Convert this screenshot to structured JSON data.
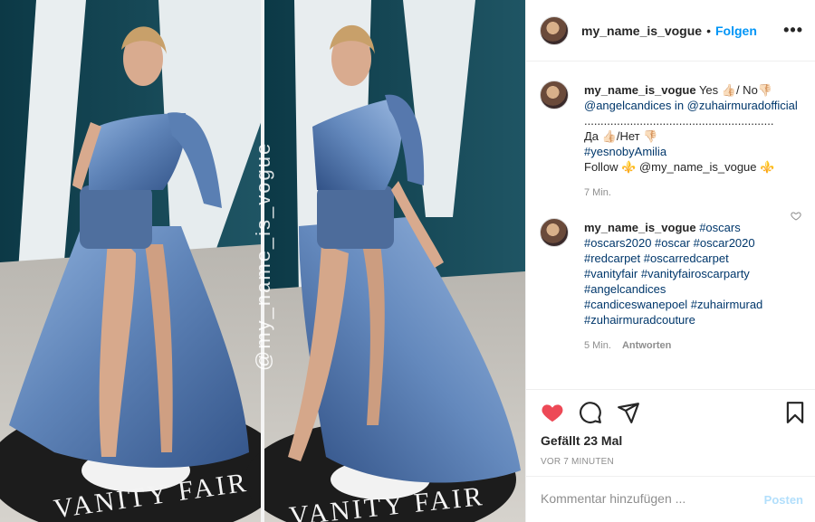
{
  "post": {
    "username": "my_name_is_vogue",
    "separator": "•",
    "follow_label": "Folgen",
    "more_label": "•••",
    "watermark": "@my_name_is_vogue"
  },
  "comments": [
    {
      "user": "my_name_is_vogue",
      "text_l1": " Yes 👍🏻/ No👎🏻",
      "text_l2": "@angelcandices in @zuhairmuradofficial",
      "text_l3": "..........................................................",
      "text_l4": "Да 👍🏻/Нет 👎🏻",
      "text_l5": "#yesnobyAmilia",
      "text_l6": "Follow ⚜️ @my_name_is_vogue ⚜️",
      "time": "7 Min."
    },
    {
      "user": "my_name_is_vogue",
      "text_l1": " #oscars",
      "text_l2": "#oscars2020 #oscar #oscar2020",
      "text_l3": "#redcarpet #oscarredcarpet",
      "text_l4": "#vanityfair #vanityfairoscarparty",
      "text_l5": "#angelcandices",
      "text_l6": "#candiceswanepoel #zuhairmurad",
      "text_l7": "#zuhairmuradcouture",
      "time": "5 Min.",
      "reply_label": "Antworten"
    }
  ],
  "actions": {
    "likes": "Gefällt 23 Mal",
    "timestamp": "VOR 7 MINUTEN",
    "heart_color": "#ed4956"
  },
  "add_comment": {
    "placeholder": "Kommentar hinzufügen ...",
    "post_label": "Posten"
  },
  "colors": {
    "link": "#0095f6",
    "hashtag": "#00376b",
    "muted": "#8e8e8e",
    "dress": "#5f84b8"
  }
}
